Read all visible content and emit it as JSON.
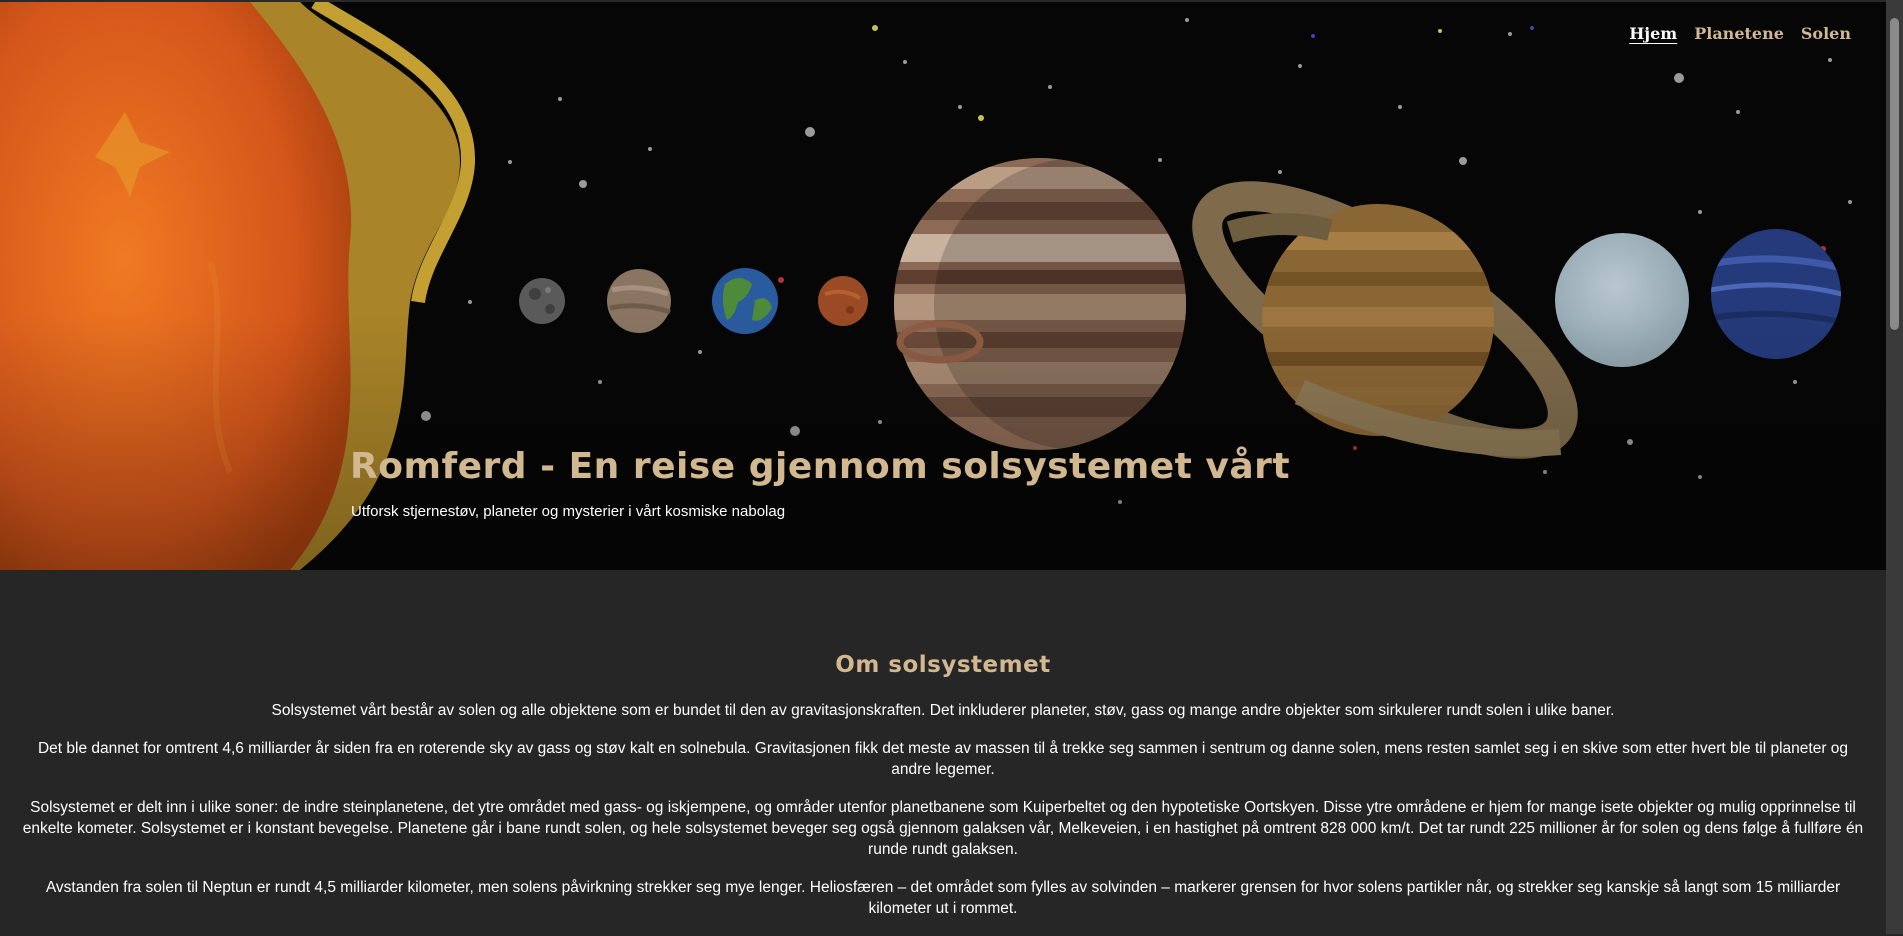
{
  "nav": {
    "items": [
      {
        "label": "Hjem",
        "active": true
      },
      {
        "label": "Planetene",
        "active": false
      },
      {
        "label": "Solen",
        "active": false
      }
    ]
  },
  "hero": {
    "title": "Romferd - En reise gjennom solsystemet vårt",
    "subtitle": "Utforsk stjernestøv, planeter og mysterier i vårt kosmiske nabolag",
    "planets": [
      "sun",
      "mercury",
      "venus",
      "earth",
      "mars",
      "jupiter",
      "saturn",
      "uranus",
      "neptune"
    ]
  },
  "about": {
    "heading": "Om solsystemet",
    "paragraphs": [
      "Solsystemet vårt består av solen og alle objektene som er bundet til den av gravitasjonskraften. Det inkluderer planeter, støv, gass og mange andre objekter som sirkulerer rundt solen i ulike baner.",
      "Det ble dannet for omtrent 4,6 milliarder år siden fra en roterende sky av gass og støv kalt en solnebula. Gravitasjonen fikk det meste av massen til å trekke seg sammen i sentrum og danne solen, mens resten samlet seg i en skive som etter hvert ble til planeter og andre legemer.",
      "Solsystemet er delt inn i ulike soner: de indre steinplanetene, det ytre området med gass- og iskjempene, og områder utenfor planetbanene som Kuiperbeltet og den hypotetiske Oortskyen. Disse ytre områdene er hjem for mange isete objekter og mulig opprinnelse til enkelte kometer. Solsystemet er i konstant bevegelse. Planetene går i bane rundt solen, og hele solsystemet beveger seg også gjennom galaksen vår, Melkeveien, i en hastighet på omtrent 828 000 km/t. Det tar rundt 225 millioner år for solen og dens følge å fullføre én runde rundt galaksen.",
      "Avstanden fra solen til Neptun er rundt 4,5 milliarder kilometer, men solens påvirkning strekker seg mye lenger. Heliosfæren – det området som fylles av solvinden – markerer grensen for hvor solens partikler når, og strekker seg kanskje så langt som 15 milliarder kilometer ut i rommet."
    ]
  },
  "colors": {
    "accent": "#d2b891",
    "page_bg": "#262626",
    "hero_bg": "#060606"
  }
}
